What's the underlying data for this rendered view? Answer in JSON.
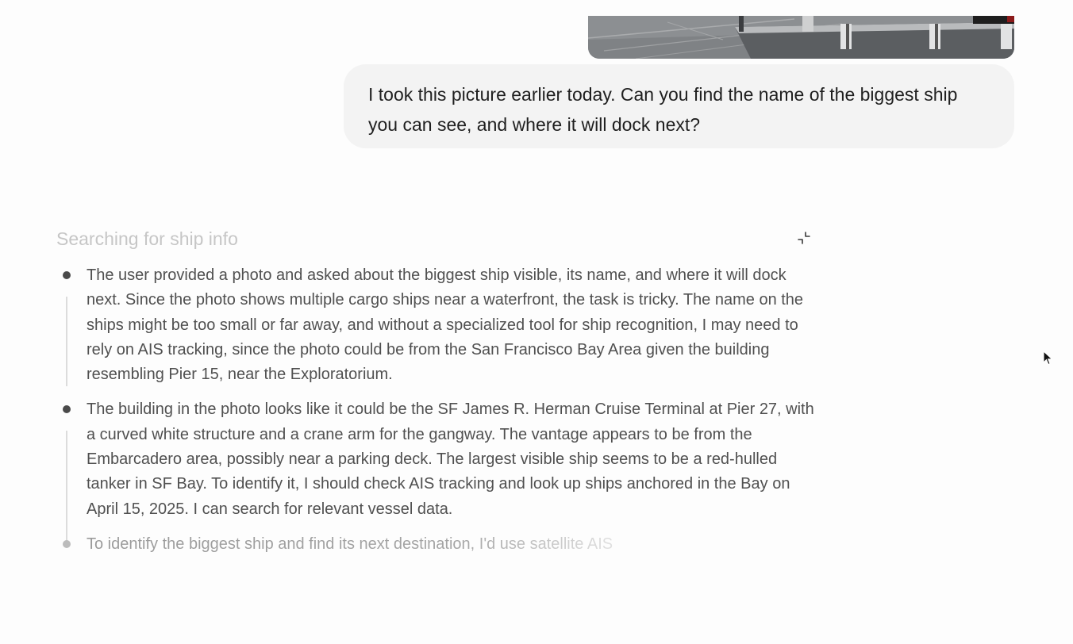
{
  "conversation": {
    "attachment": {
      "label": "user photo of waterfront"
    },
    "user_message": {
      "text": "I took this picture earlier today. Can you find the name of the biggest ship you can see, and where it will dock next?"
    }
  },
  "reasoning": {
    "title": "Searching for ship info",
    "collapse_icon": "collapse-arrows-icon",
    "steps": [
      {
        "text": "The user provided a photo and asked about the biggest ship visible, its name, and where it will dock next. Since the photo shows multiple cargo ships near a waterfront, the task is tricky. The name on the ships might be too small or far away, and without a specialized tool for ship recognition, I may need to rely on AIS tracking, since the photo could be from the San Francisco Bay Area given the building resembling Pier 15, near the Exploratorium."
      },
      {
        "text": "The building in the photo looks like it could be the SF James R. Herman Cruise Terminal at Pier 27, with a curved white structure and a crane arm for the gangway. The vantage appears to be from the Embarcadero area, possibly near a parking deck. The largest visible ship seems to be a red-hulled tanker in SF Bay. To identify it, I should check AIS tracking and look up ships anchored in the Bay on April 15, 2025. I can search for relevant vessel data."
      },
      {
        "text": "To identify the biggest ship and find its next destination, I'd use satellite AIS"
      }
    ]
  },
  "colors": {
    "bubble_bg": "#f3f3f3",
    "title_gray": "#c6c6c6",
    "body_text": "#505050",
    "rail": "#dcdcdc"
  },
  "pointer_icon": "mouse-pointer-icon"
}
